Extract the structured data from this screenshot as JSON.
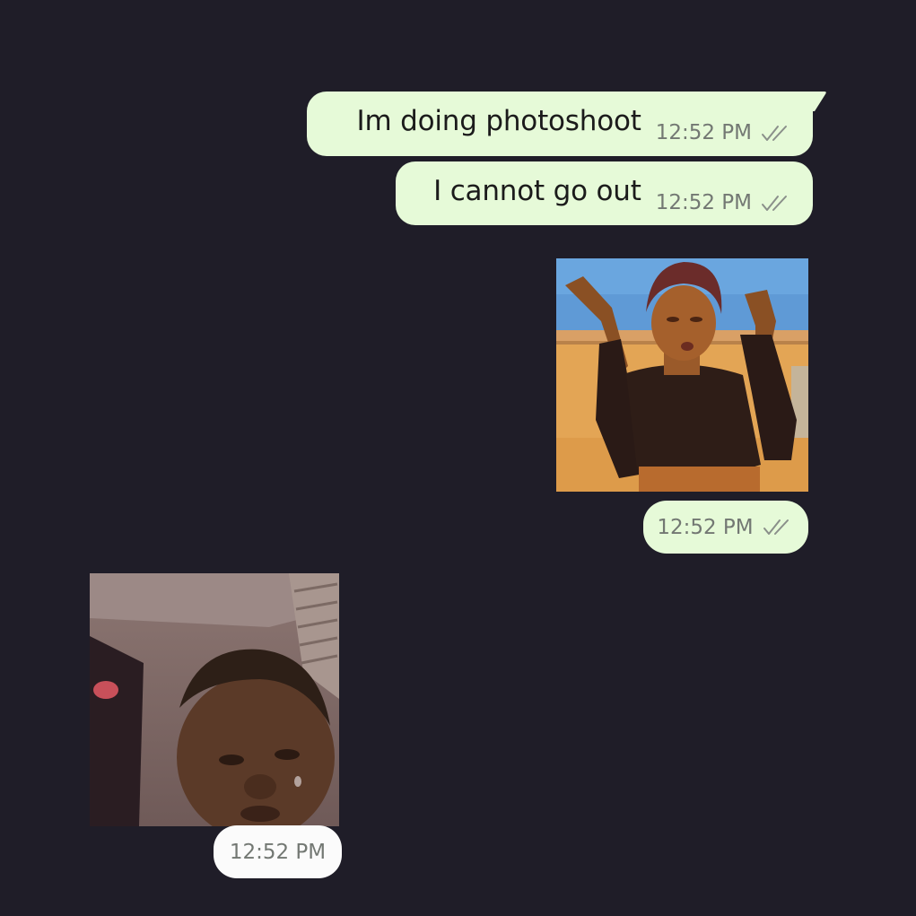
{
  "messages": [
    {
      "text": "Im doing photoshoot",
      "time": "12:52 PM",
      "status": "read-double-tick-icon"
    },
    {
      "text": "I cannot go out",
      "time": "12:52 PM",
      "status": "read-double-tick-icon"
    }
  ],
  "images": [
    {
      "direction": "outgoing",
      "time": "12:52 PM",
      "status": "read-double-tick-icon"
    },
    {
      "direction": "incoming",
      "time": "12:52 PM"
    }
  ],
  "colors": {
    "background": "#1f1d28",
    "outgoing_bubble": "#e6fad8",
    "incoming_pill": "#fbfbfb",
    "meta_text": "#737873"
  }
}
